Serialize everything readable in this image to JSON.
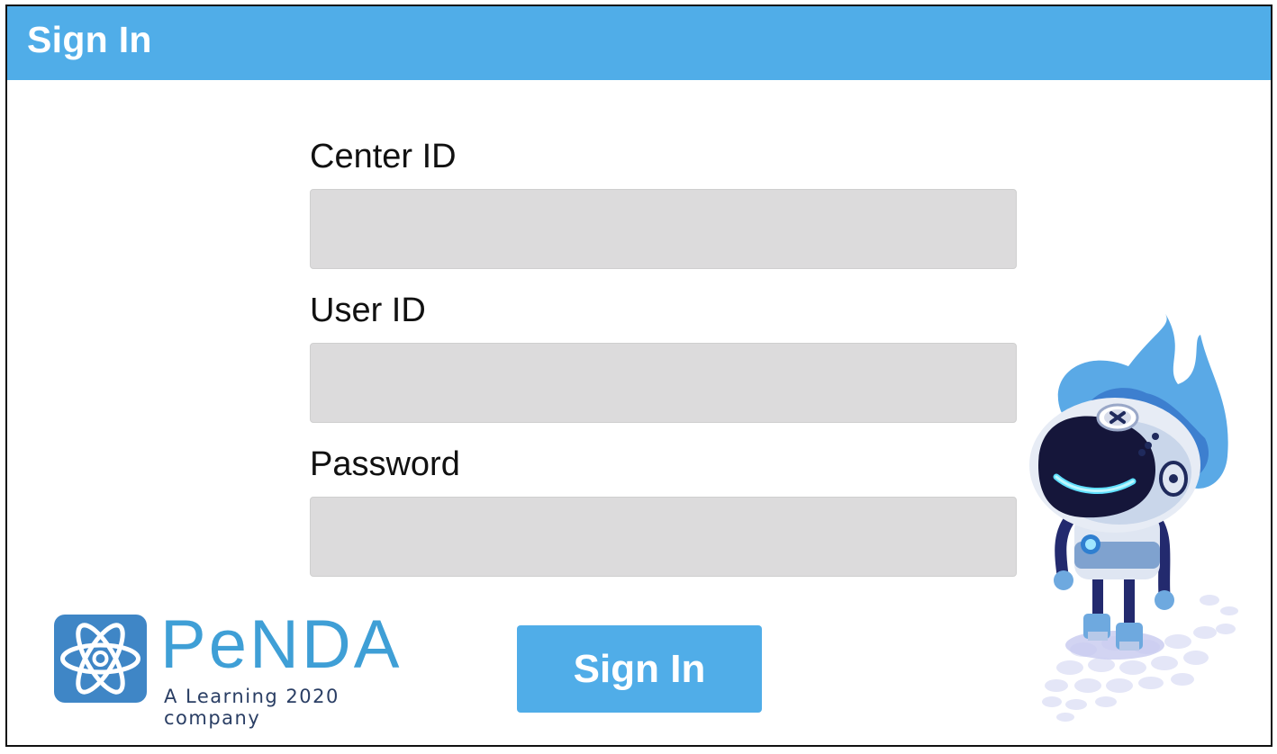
{
  "header": {
    "title": "Sign In"
  },
  "form": {
    "center_id": {
      "label": "Center ID",
      "value": "",
      "placeholder": ""
    },
    "user_id": {
      "label": "User ID",
      "value": "",
      "placeholder": ""
    },
    "password": {
      "label": "Password",
      "value": "",
      "placeholder": ""
    },
    "submit_label": "Sign In"
  },
  "logo": {
    "wordmark": "PeNDA",
    "tagline": "A Learning 2020 company",
    "icon": "atom-icon"
  },
  "mascot": {
    "icon": "robot-mascot-icon"
  },
  "colors": {
    "header": "#50ade8",
    "button": "#50ade8",
    "input_bg": "#dcdbdc",
    "logo_blue": "#3f9fd6",
    "logo_navy": "#2a3e64"
  }
}
